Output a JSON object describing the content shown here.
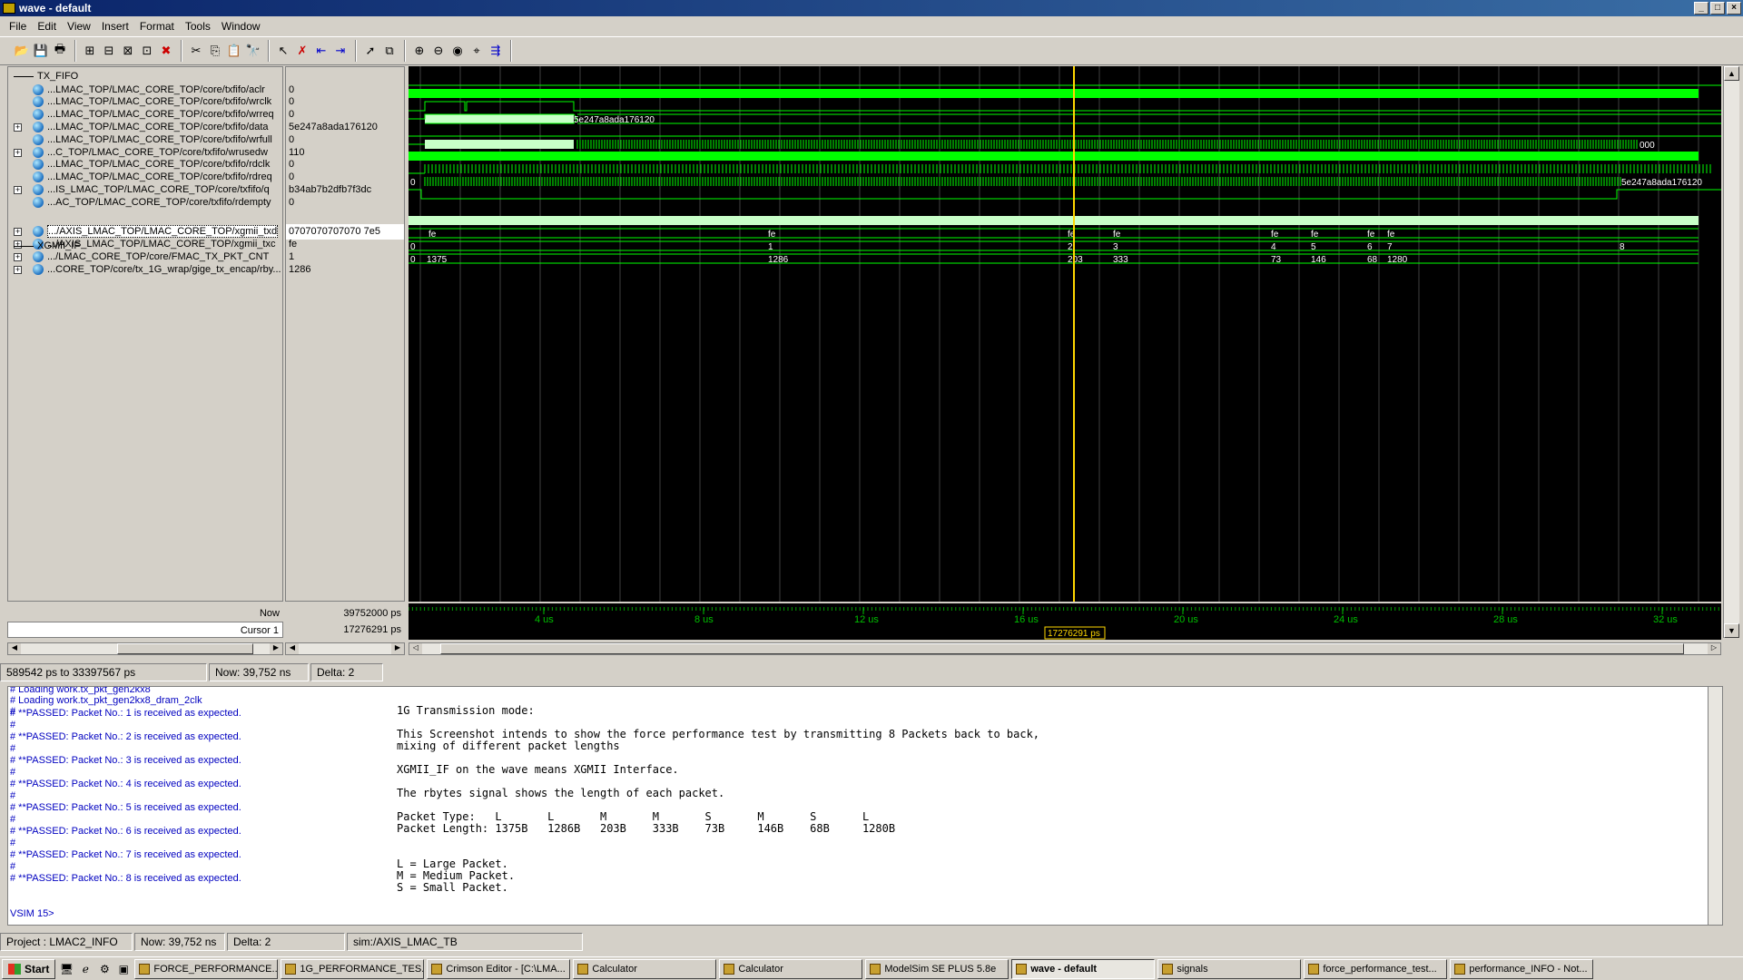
{
  "window": {
    "title": "wave - default"
  },
  "menu": [
    "File",
    "Edit",
    "View",
    "Insert",
    "Format",
    "Tools",
    "Window"
  ],
  "groups": {
    "tx_fifo": "TX_FIFO",
    "xgmii_if": "XGMII_IF"
  },
  "signals": [
    {
      "name": "...LMAC_TOP/LMAC_CORE_TOP/core/txfifo/aclr",
      "value": "0",
      "expandable": false
    },
    {
      "name": "...LMAC_TOP/LMAC_CORE_TOP/core/txfifo/wrclk",
      "value": "0",
      "expandable": false
    },
    {
      "name": "...LMAC_TOP/LMAC_CORE_TOP/core/txfifo/wrreq",
      "value": "0",
      "expandable": false
    },
    {
      "name": "...LMAC_TOP/LMAC_CORE_TOP/core/txfifo/data",
      "value": "5e247a8ada176120",
      "expandable": true
    },
    {
      "name": "...LMAC_TOP/LMAC_CORE_TOP/core/txfifo/wrfull",
      "value": "0",
      "expandable": false
    },
    {
      "name": "...C_TOP/LMAC_CORE_TOP/core/txfifo/wrusedw",
      "value": "110",
      "expandable": true
    },
    {
      "name": "...LMAC_TOP/LMAC_CORE_TOP/core/txfifo/rdclk",
      "value": "0",
      "expandable": false
    },
    {
      "name": "...LMAC_TOP/LMAC_CORE_TOP/core/txfifo/rdreq",
      "value": "0",
      "expandable": false
    },
    {
      "name": "...IS_LMAC_TOP/LMAC_CORE_TOP/core/txfifo/q",
      "value": "b34ab7b2dfb7f3dc",
      "expandable": true
    },
    {
      "name": "...AC_TOP/LMAC_CORE_TOP/core/txfifo/rdempty",
      "value": "0",
      "expandable": false
    },
    {
      "name": ".../AXIS_LMAC_TOP/LMAC_CORE_TOP/xgmii_txd",
      "value": "0707070707070 7e5",
      "expandable": true
    },
    {
      "name": ".../AXIS_LMAC_TOP/LMAC_CORE_TOP/xgmii_txc",
      "value": "fe",
      "expandable": true
    },
    {
      "name": ".../LMAC_CORE_TOP/core/FMAC_TX_PKT_CNT",
      "value": "1",
      "expandable": true
    },
    {
      "name": "...CORE_TOP/core/tx_1G_wrap/gige_tx_encap/rby...",
      "value": "1286",
      "expandable": true
    }
  ],
  "footer": {
    "now_label": "Now",
    "now_value": "39752000 ps",
    "cursor_label": "Cursor 1",
    "cursor_value": "17276291 ps",
    "cursor_marker": "17276291 ps"
  },
  "timeline": {
    "ticks": [
      "4 us",
      "8 us",
      "12 us",
      "16 us",
      "20 us",
      "24 us",
      "28 us",
      "32 us"
    ]
  },
  "wave_labels": {
    "data_a": "5e247a8ada176120",
    "wrusedw_end": "000",
    "q_start": "0",
    "q_end": "5e247a8ada176120",
    "txc": [
      "fe",
      "fe",
      "fe",
      "fe",
      "fe",
      "fe",
      "fe",
      "fe"
    ],
    "pktcnt": [
      "0",
      "1",
      "2",
      "3",
      "4",
      "5",
      "6",
      "7",
      "8"
    ],
    "rbytes": [
      "0",
      "1375",
      "1286",
      "203",
      "333",
      "73",
      "146",
      "68",
      "1280"
    ]
  },
  "status1": {
    "range": "589542 ps to 33397567 ps",
    "now": "Now: 39,752 ns",
    "delta": "Delta: 2"
  },
  "transcript": {
    "lines": [
      "# Loading work.tx_pkt_gen2kx8",
      "# Loading work.tx_pkt_gen2kx8_dram_2clk",
      "#",
      "# **PASSED: Packet No.: 1  is received as expected.",
      "#",
      "# **PASSED: Packet No.: 2  is received as expected.",
      "#",
      "# **PASSED: Packet No.: 3  is received as expected.",
      "#",
      "# **PASSED: Packet No.: 4  is received as expected.",
      "#",
      "# **PASSED: Packet No.: 5  is received as expected.",
      "#",
      "# **PASSED: Packet No.: 6  is received as expected.",
      "#",
      "# **PASSED: Packet No.: 7  is received as expected.",
      "#",
      "# **PASSED: Packet No.: 8  is received as expected.",
      "",
      "VSIM 15>"
    ],
    "note_lines": [
      "1G Transmission mode:",
      "",
      "This Screenshot intends to show the force performance test by transmitting 8 Packets back to back,",
      "mixing of different packet lengths",
      "",
      "XGMII_IF on the wave means XGMII Interface.",
      "",
      "The rbytes signal shows the length of each packet.",
      "",
      "Packet Type:   L       L       M       M       S       M       S       L",
      "Packet Length: 1375B   1286B   203B    333B    73B     146B    68B     1280B",
      "",
      "",
      "L = Large Packet.",
      "M = Medium Packet.",
      "S = Small Packet."
    ]
  },
  "status2": {
    "project": "Project : LMAC2_INFO",
    "now": "Now: 39,752 ns",
    "delta": "Delta: 2",
    "sim": "sim:/AXIS_LMAC_TB"
  },
  "taskbar": {
    "start": "Start",
    "tasks": [
      "FORCE_PERFORMANCE...",
      "1G_PERFORMANCE_TES...",
      "Crimson Editor - [C:\\LMA...",
      "Calculator",
      "Calculator",
      "ModelSim SE PLUS 5.8e",
      "wave - default",
      "signals",
      "force_performance_test...",
      "performance_INFO - Not..."
    ],
    "active_index": 6
  },
  "colors": {
    "wave_green": "#00ff00",
    "cursor": "#ffd700",
    "title_bg": "#0a246a",
    "transcript_text": "#0000c0"
  }
}
